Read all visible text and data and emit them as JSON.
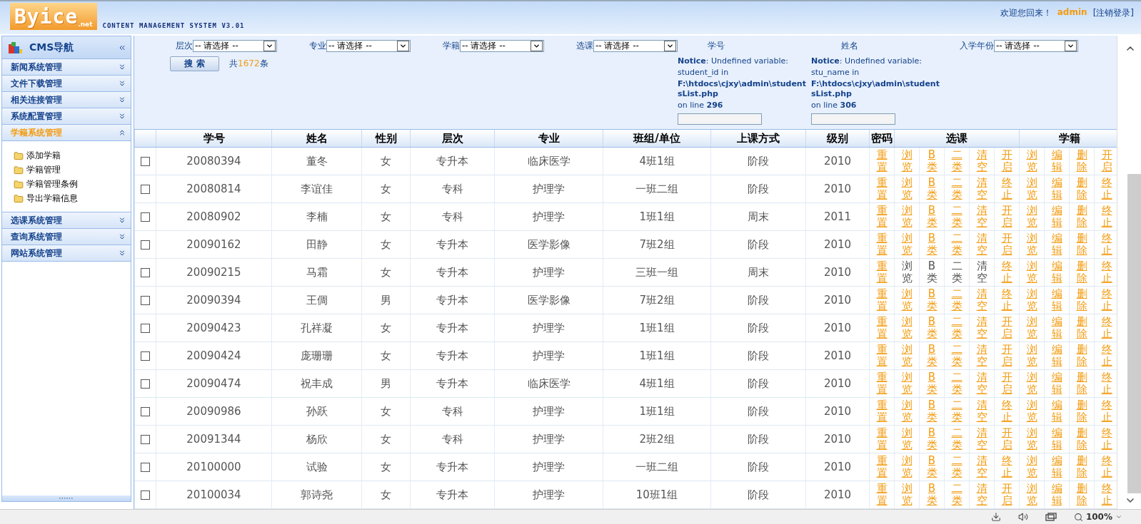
{
  "header": {
    "logo": "Byice",
    "logo_suffix": ".net",
    "subtitle": "CONTENT MANAGEMENT SYSTEM V3.01",
    "welcome": "欢迎您回来！",
    "user": "admin",
    "logout": "[注销登录]"
  },
  "sidebar": {
    "title": "CMS导航",
    "sections": [
      {
        "label": "新闻系统管理",
        "expanded": false
      },
      {
        "label": "文件下载管理",
        "expanded": false
      },
      {
        "label": "相关连接管理",
        "expanded": false
      },
      {
        "label": "系统配置管理",
        "expanded": false
      },
      {
        "label": "学籍系统管理",
        "expanded": true,
        "children": [
          "添加学籍",
          "学籍管理",
          "学籍管理条例",
          "导出学籍信息"
        ]
      },
      {
        "label": "选课系统管理",
        "expanded": false
      },
      {
        "label": "查询系统管理",
        "expanded": false
      },
      {
        "label": "网站系统管理",
        "expanded": false
      }
    ]
  },
  "filters": [
    {
      "kind": "select",
      "label": "层次",
      "value": "-- 请选择 --"
    },
    {
      "kind": "select",
      "label": "专业",
      "value": "-- 请选择 --"
    },
    {
      "kind": "select",
      "label": "学籍",
      "value": "-- 请选择 --"
    },
    {
      "kind": "select",
      "label": "选课",
      "value": "-- 请选择 --"
    },
    {
      "kind": "text",
      "label": "学号",
      "notice": {
        "message": "**Notice**: Undefined variable:",
        "variable": "student_id in",
        "path": "F:\\htdocs\\cjxy\\admin\\studentsList.php",
        "line": "on line **296**"
      }
    },
    {
      "kind": "text",
      "label": "姓名",
      "notice": {
        "message": "**Notice**: Undefined variable:",
        "variable": "stu_name in",
        "path": "F:\\htdocs\\cjxy\\admin\\studentsList.php",
        "line": "on line **306**"
      }
    },
    {
      "kind": "select",
      "label": "入学年份",
      "value": "-- 请选择 --"
    }
  ],
  "search": {
    "button": "搜 索",
    "count_prefix": "共",
    "count": "1672",
    "count_suffix": "条"
  },
  "table": {
    "columns": [
      "学号",
      "姓名",
      "性别",
      "层次",
      "专业",
      "班组/单位",
      "上课方式",
      "级别"
    ],
    "action_groups": [
      "密码",
      "选课",
      "学籍"
    ],
    "rows": [
      {
        "checked": false,
        "cells": [
          "20080394",
          "董冬",
          "女",
          "专升本",
          "临床医学",
          "4班1组",
          "阶段",
          "2010"
        ],
        "course_disabled": false,
        "actions": [
          "重置",
          "浏览",
          "B类",
          "二类",
          "清空",
          "开启",
          "浏览",
          "编辑",
          "删除",
          "开启"
        ]
      },
      {
        "checked": false,
        "cells": [
          "20080814",
          "李谊佳",
          "女",
          "专科",
          "护理学",
          "一班二组",
          "阶段",
          "2010"
        ],
        "course_disabled": false,
        "actions": [
          "重置",
          "浏览",
          "B类",
          "二类",
          "清空",
          "终止",
          "浏览",
          "编辑",
          "删除",
          "终止"
        ]
      },
      {
        "checked": false,
        "cells": [
          "20080902",
          "李楠",
          "女",
          "专科",
          "护理学",
          "1班1组",
          "周末",
          "2011"
        ],
        "course_disabled": false,
        "actions": [
          "重置",
          "浏览",
          "B类",
          "二类",
          "清空",
          "开启",
          "浏览",
          "编辑",
          "删除",
          "终止"
        ]
      },
      {
        "checked": false,
        "cells": [
          "20090162",
          "田静",
          "女",
          "专升本",
          "医学影像",
          "7班2组",
          "阶段",
          "2010"
        ],
        "course_disabled": false,
        "actions": [
          "重置",
          "浏览",
          "B类",
          "二类",
          "清空",
          "开启",
          "浏览",
          "编辑",
          "删除",
          "终止"
        ]
      },
      {
        "checked": false,
        "cells": [
          "20090215",
          "马霜",
          "女",
          "专升本",
          "护理学",
          "三班一组",
          "周末",
          "2010"
        ],
        "course_disabled": true,
        "actions": [
          "重置",
          "浏览",
          "B类",
          "二类",
          "清空",
          "终止",
          "浏览",
          "编辑",
          "删除",
          "终止"
        ]
      },
      {
        "checked": false,
        "cells": [
          "20090394",
          "王倜",
          "男",
          "专升本",
          "医学影像",
          "7班2组",
          "阶段",
          "2010"
        ],
        "course_disabled": false,
        "actions": [
          "重置",
          "浏览",
          "B类",
          "二类",
          "清空",
          "终止",
          "浏览",
          "编辑",
          "删除",
          "终止"
        ]
      },
      {
        "checked": false,
        "cells": [
          "20090423",
          "孔祥凝",
          "女",
          "专升本",
          "护理学",
          "1班1组",
          "阶段",
          "2010"
        ],
        "course_disabled": false,
        "actions": [
          "重置",
          "浏览",
          "B类",
          "二类",
          "清空",
          "开启",
          "浏览",
          "编辑",
          "删除",
          "终止"
        ]
      },
      {
        "checked": false,
        "cells": [
          "20090424",
          "庞珊珊",
          "女",
          "专升本",
          "护理学",
          "1班1组",
          "阶段",
          "2010"
        ],
        "course_disabled": false,
        "actions": [
          "重置",
          "浏览",
          "B类",
          "二类",
          "清空",
          "开启",
          "浏览",
          "编辑",
          "删除",
          "终止"
        ]
      },
      {
        "checked": false,
        "cells": [
          "20090474",
          "祝丰成",
          "男",
          "专升本",
          "临床医学",
          "4班1组",
          "阶段",
          "2010"
        ],
        "course_disabled": false,
        "actions": [
          "重置",
          "浏览",
          "B类",
          "二类",
          "清空",
          "开启",
          "浏览",
          "编辑",
          "删除",
          "终止"
        ]
      },
      {
        "checked": false,
        "cells": [
          "20090986",
          "孙跃",
          "女",
          "专科",
          "护理学",
          "1班1组",
          "阶段",
          "2010"
        ],
        "course_disabled": false,
        "actions": [
          "重置",
          "浏览",
          "B类",
          "二类",
          "清空",
          "终止",
          "浏览",
          "编辑",
          "删除",
          "终止"
        ]
      },
      {
        "checked": false,
        "cells": [
          "20091344",
          "杨欣",
          "女",
          "专科",
          "护理学",
          "2班2组",
          "阶段",
          "2010"
        ],
        "course_disabled": false,
        "actions": [
          "重置",
          "浏览",
          "B类",
          "二类",
          "清空",
          "开启",
          "浏览",
          "编辑",
          "删除",
          "终止"
        ]
      },
      {
        "checked": false,
        "cells": [
          "20100000",
          "试验",
          "女",
          "专升本",
          "护理学",
          "一班二组",
          "阶段",
          "2010"
        ],
        "course_disabled": false,
        "actions": [
          "重置",
          "浏览",
          "B类",
          "二类",
          "清空",
          "终止",
          "浏览",
          "编辑",
          "删除",
          "终止"
        ]
      },
      {
        "checked": false,
        "cells": [
          "20100034",
          "郭诗尧",
          "女",
          "专升本",
          "护理学",
          "10班1组",
          "阶段",
          "2010"
        ],
        "course_disabled": false,
        "actions": [
          "重置",
          "浏览",
          "B类",
          "二类",
          "清空",
          "开启",
          "浏览",
          "编辑",
          "删除",
          "终止"
        ]
      }
    ]
  },
  "status_bar": {
    "zoom": "100%"
  }
}
